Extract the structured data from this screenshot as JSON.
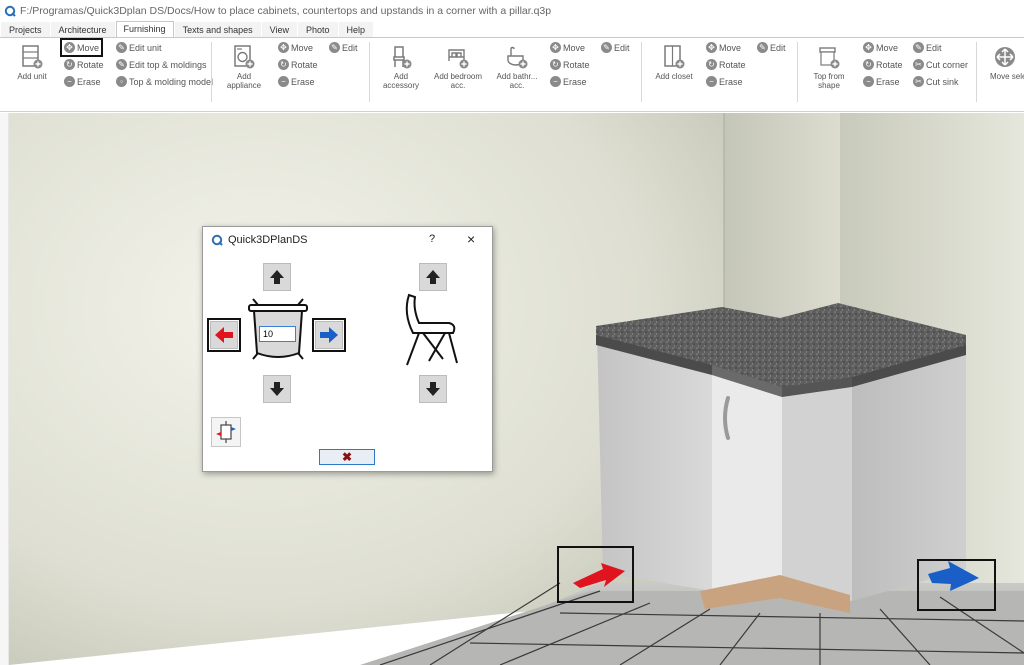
{
  "window": {
    "title": "F:/Programas/Quick3Dplan DS/Docs/How to place cabinets, countertops and upstands in a corner with a pillar.q3p"
  },
  "tabs": [
    {
      "label": "Projects",
      "active": false
    },
    {
      "label": "Architecture",
      "active": false
    },
    {
      "label": "Furnishing",
      "active": true
    },
    {
      "label": "Texts and shapes",
      "active": false
    },
    {
      "label": "View",
      "active": false
    },
    {
      "label": "Photo",
      "active": false
    },
    {
      "label": "Help",
      "active": false
    }
  ],
  "ribbon": {
    "unit": {
      "add_label": "Add unit",
      "move": "Move",
      "rotate": "Rotate",
      "erase": "Erase",
      "edit_unit": "Edit unit",
      "edit_top": "Edit top & moldings",
      "top_molding_model": "Top & molding model"
    },
    "appliance": {
      "add_label": "Add appliance",
      "move": "Move",
      "rotate": "Rotate",
      "erase": "Erase",
      "edit": "Edit"
    },
    "accessory": {
      "add_accessory": "Add accessory",
      "add_bedroom": "Add bedroom acc.",
      "add_bathroom": "Add bathr... acc.",
      "move": "Move",
      "rotate": "Rotate",
      "erase": "Erase",
      "edit": "Edit"
    },
    "closet": {
      "add_label": "Add closet",
      "move": "Move",
      "rotate": "Rotate",
      "erase": "Erase",
      "edit": "Edit"
    },
    "top": {
      "add_label": "Top from shape",
      "move": "Move",
      "rotate": "Rotate",
      "erase": "Erase",
      "edit": "Edit",
      "cut_corner": "Cut corner",
      "cut_sink": "Cut sink"
    },
    "selection": {
      "move_label": "Move selection"
    }
  },
  "dialog": {
    "title": "Quick3DPlanDS",
    "help": "?",
    "close": "×",
    "distance_value": "10",
    "cancel": "✖"
  },
  "colors": {
    "accent_red": "#e0141e",
    "accent_blue": "#1a5fc8",
    "ribbon_icon": "#8a8a8a"
  }
}
